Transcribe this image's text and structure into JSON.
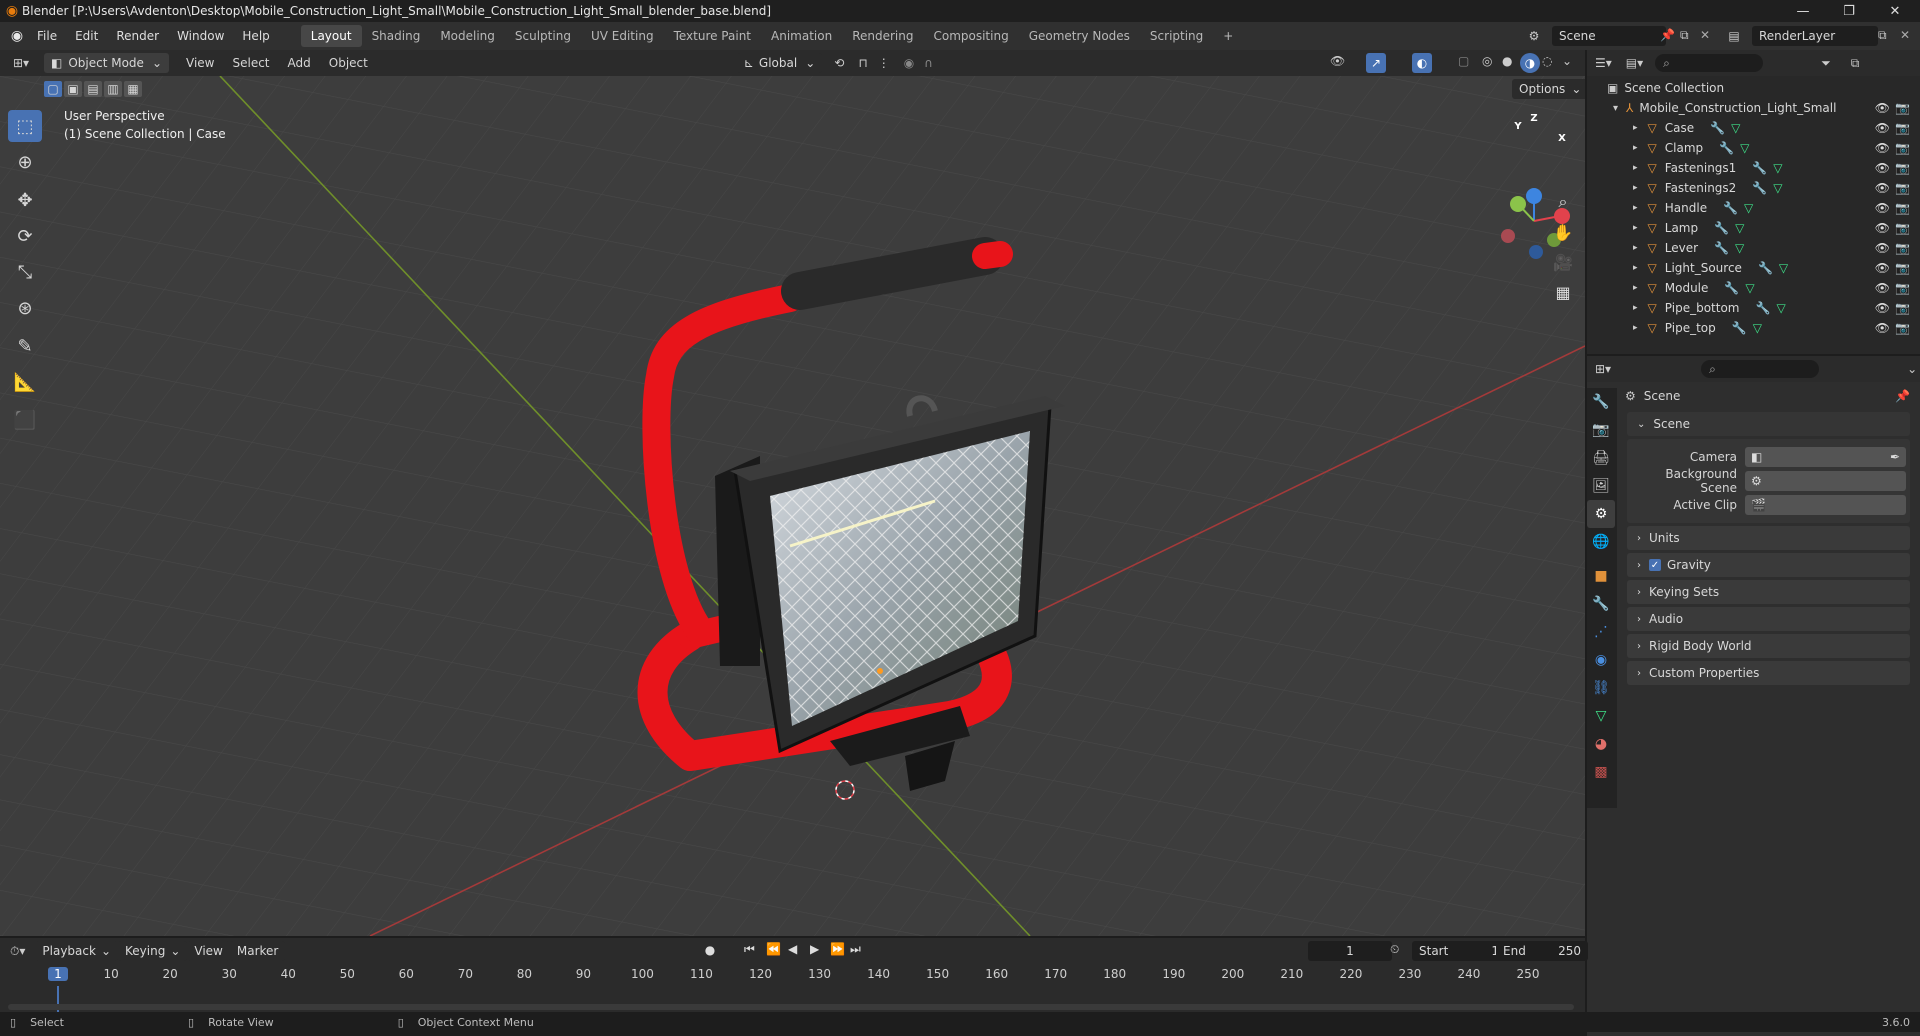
{
  "window": {
    "title": "Blender [P:\\Users\\Avdenton\\Desktop\\Mobile_Construction_Light_Small\\Mobile_Construction_Light_Small_blender_base.blend]",
    "minimize": "—",
    "restore": "❐",
    "close": "✕"
  },
  "menu": {
    "items": [
      "File",
      "Edit",
      "Render",
      "Window",
      "Help"
    ],
    "workspaces": [
      "Layout",
      "Shading",
      "Modeling",
      "Sculpting",
      "UV Editing",
      "Texture Paint",
      "Animation",
      "Rendering",
      "Compositing",
      "Geometry Nodes",
      "Scripting"
    ],
    "active_workspace": "Layout",
    "add_tab": "+",
    "scene_name": "Scene",
    "render_layer": "RenderLayer"
  },
  "viewport_header": {
    "mode": "Object Mode",
    "menus": [
      "View",
      "Select",
      "Add",
      "Object"
    ],
    "orientation": "Global",
    "options": "Options"
  },
  "viewport": {
    "perspective": "User Perspective",
    "context": "(1) Scene Collection | Case",
    "gizmo": {
      "x": "X",
      "y": "Y",
      "z": "Z"
    }
  },
  "outliner": {
    "root": "Scene Collection",
    "collection": "Mobile_Construction_Light_Small",
    "objects": [
      "Case",
      "Clamp",
      "Fastenings1",
      "Fastenings2",
      "Handle",
      "Lamp",
      "Lever",
      "Light_Source",
      "Module",
      "Pipe_bottom",
      "Pipe_top"
    ]
  },
  "properties": {
    "header": "Scene",
    "section": "Scene",
    "fields": {
      "camera": "Camera",
      "background_scene": "Background Scene",
      "active_clip": "Active Clip"
    },
    "panels": [
      "Units",
      "Gravity",
      "Keying Sets",
      "Audio",
      "Rigid Body World",
      "Custom Properties"
    ],
    "gravity_checked": true
  },
  "timeline": {
    "menus": [
      "Playback",
      "Keying",
      "View",
      "Marker"
    ],
    "current_frame": "1",
    "start_label": "Start",
    "start": "1",
    "end_label": "End",
    "end": "250",
    "ticks": [
      "1",
      "10",
      "20",
      "30",
      "40",
      "50",
      "60",
      "70",
      "80",
      "90",
      "100",
      "110",
      "120",
      "130",
      "140",
      "150",
      "160",
      "170",
      "180",
      "190",
      "200",
      "210",
      "220",
      "230",
      "240",
      "250"
    ]
  },
  "status_bar": {
    "select": "Select",
    "rotate": "Rotate View",
    "context_menu": "Object Context Menu",
    "version": "3.6.0"
  },
  "colors": {
    "accent": "#4872b3",
    "mesh_icon": "#e0913a",
    "pipe_red": "#e8141a",
    "x_axis": "#e2424c",
    "y_axis": "#8bc34a",
    "z_axis": "#3d85e0"
  }
}
